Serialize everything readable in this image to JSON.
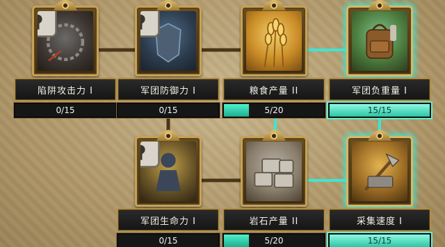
{
  "colors": {
    "progress_fill": "#2fd1ac",
    "glow": "#3ce6d2",
    "frame_gold": "#c6a257",
    "title_bg": "#1c1c1c",
    "background": "#b7a073"
  },
  "nodes": [
    {
      "id": "trap-attack",
      "title": "陷阱攻击力 I",
      "progress_text": "0/15",
      "current": 0,
      "max": 15,
      "locked": true,
      "maxed": false,
      "icon": "lock-icon"
    },
    {
      "id": "legion-defense",
      "title": "军团防御力 I",
      "progress_text": "0/15",
      "current": 0,
      "max": 15,
      "locked": true,
      "maxed": false,
      "icon": "lock-icon"
    },
    {
      "id": "grain-yield",
      "title": "粮食产量 II",
      "progress_text": "5/20",
      "current": 5,
      "max": 20,
      "locked": false,
      "maxed": false,
      "icon": "wheat-icon"
    },
    {
      "id": "legion-load",
      "title": "军团负重量 I",
      "progress_text": "15/15",
      "current": 15,
      "max": 15,
      "locked": false,
      "maxed": true,
      "icon": "backpack-icon"
    },
    {
      "id": "legion-health",
      "title": "军团生命力 I",
      "progress_text": "0/15",
      "current": 0,
      "max": 15,
      "locked": true,
      "maxed": false,
      "icon": "lock-icon"
    },
    {
      "id": "stone-yield",
      "title": "岩石产量 II",
      "progress_text": "5/20",
      "current": 5,
      "max": 20,
      "locked": false,
      "maxed": false,
      "icon": "stone-blocks-icon"
    },
    {
      "id": "gather-speed",
      "title": "采集速度 I",
      "progress_text": "15/15",
      "current": 15,
      "max": 15,
      "locked": false,
      "maxed": true,
      "icon": "gathering-tools-icon"
    }
  ]
}
